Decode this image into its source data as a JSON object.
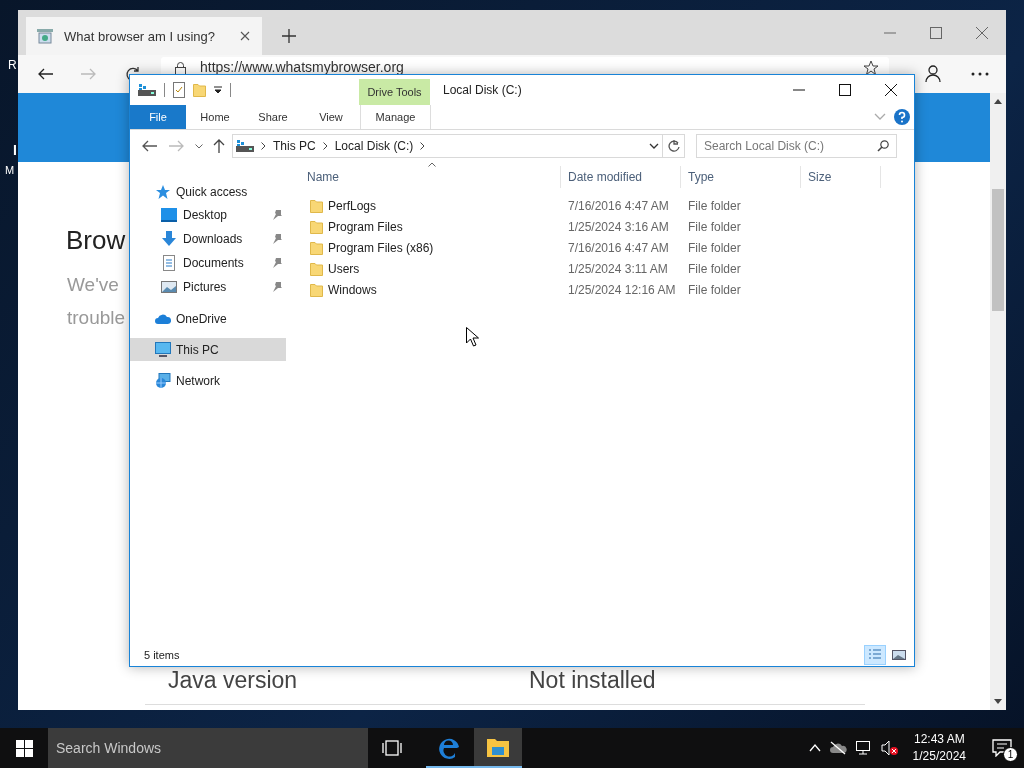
{
  "desktop": {
    "label_fragments": [
      "R",
      "I",
      "M"
    ]
  },
  "browser": {
    "tab": {
      "title": "What browser am I using?"
    },
    "address": "https://www.whatsmybrowser.org",
    "heading": "Brow",
    "text_lines": [
      "We've",
      "trouble"
    ],
    "rows": [
      {
        "label": "Java version",
        "value": "Not installed"
      }
    ]
  },
  "explorer": {
    "title": "Local Disk (C:)",
    "context_group": "Drive Tools",
    "ribbon_tabs": [
      {
        "label": "File",
        "kind": "file"
      },
      {
        "label": "Home",
        "kind": "normal"
      },
      {
        "label": "Share",
        "kind": "normal"
      },
      {
        "label": "View",
        "kind": "normal"
      },
      {
        "label": "Manage",
        "kind": "context"
      }
    ],
    "breadcrumb": [
      "This PC",
      "Local Disk (C:)"
    ],
    "search": {
      "placeholder": "Search Local Disk (C:)"
    },
    "nav": [
      {
        "label": "Quick access",
        "kind": "quick",
        "selected": false,
        "children": [
          {
            "label": "Desktop",
            "kind": "desktop",
            "pinned": true,
            "selected": false
          },
          {
            "label": "Downloads",
            "kind": "downloads",
            "pinned": true,
            "selected": false
          },
          {
            "label": "Documents",
            "kind": "documents",
            "pinned": true,
            "selected": false
          },
          {
            "label": "Pictures",
            "kind": "pictures",
            "pinned": true,
            "selected": false
          }
        ]
      },
      {
        "label": "OneDrive",
        "kind": "cloud",
        "selected": false
      },
      {
        "label": "This PC",
        "kind": "pc",
        "selected": true
      },
      {
        "label": "Network",
        "kind": "network",
        "selected": false
      }
    ],
    "columns": [
      "Name",
      "Date modified",
      "Type",
      "Size"
    ],
    "rows": [
      {
        "name": "PerfLogs",
        "date": "7/16/2016 4:47 AM",
        "type": "File folder"
      },
      {
        "name": "Program Files",
        "date": "1/25/2024 3:16 AM",
        "type": "File folder"
      },
      {
        "name": "Program Files (x86)",
        "date": "7/16/2016 4:47 AM",
        "type": "File folder"
      },
      {
        "name": "Users",
        "date": "1/25/2024 3:11 AM",
        "type": "File folder"
      },
      {
        "name": "Windows",
        "date": "1/25/2024 12:16 AM",
        "type": "File folder"
      }
    ],
    "status": "5 items",
    "view_buttons": [
      {
        "kind": "details",
        "selected": true
      },
      {
        "kind": "large_icons",
        "selected": false
      }
    ]
  },
  "taskbar": {
    "search_placeholder": "Search Windows",
    "apps": [
      {
        "kind": "edge",
        "active": false
      },
      {
        "kind": "explorer",
        "active": true
      }
    ],
    "time": "12:43 AM",
    "date": "1/25/2024",
    "notification_count": "1"
  }
}
